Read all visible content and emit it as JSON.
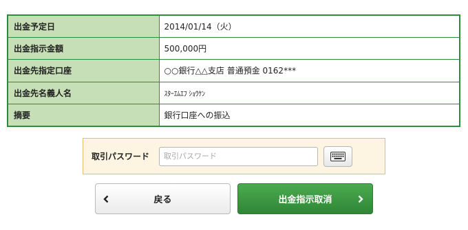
{
  "details": [
    {
      "label": "出金予定日",
      "value": "2014/01/14（火）"
    },
    {
      "label": "出金指示金額",
      "value": "500,000円"
    },
    {
      "label": "出金先指定口座",
      "value": "○○銀行△△支店 普通預金 0162***"
    },
    {
      "label": "出金先名義人名",
      "value": "ｽﾀｰｴﾑｴﾌ ｼｮｳｹﾝ"
    },
    {
      "label": "摘要",
      "value": "銀行口座への振込"
    }
  ],
  "password": {
    "label": "取引パスワード",
    "placeholder": "取引パスワード",
    "value": "",
    "keyboard_icon": "keyboard-icon"
  },
  "buttons": {
    "back_label": "戻る",
    "back_icon": "chevron-left-icon",
    "cancel_label": "出金指示取消",
    "cancel_icon": "chevron-right-icon"
  },
  "colors": {
    "table_border": "#2e8b3a",
    "label_bg": "#c6dfb6",
    "password_bg": "#fdf5e1",
    "password_border": "#e6bf6a",
    "primary_button": "#3a9a40"
  }
}
